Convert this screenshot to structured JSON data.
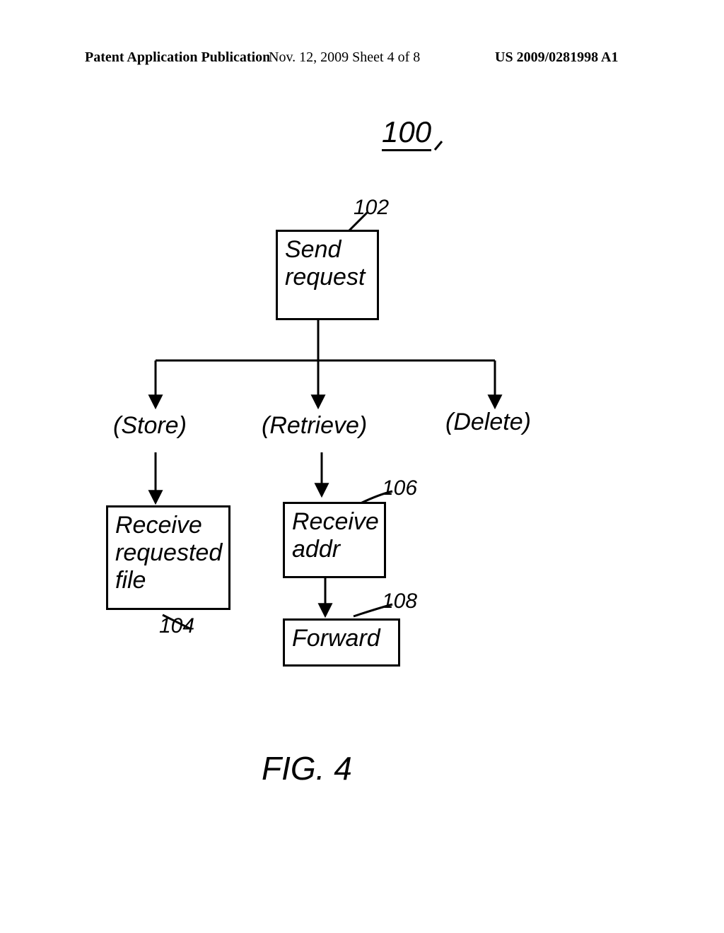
{
  "header": {
    "left": "Patent Application Publication",
    "center": "Nov. 12, 2009  Sheet 4 of 8",
    "right": "US 2009/0281998 A1"
  },
  "refs": {
    "overall": "100",
    "send": "102",
    "recvfile": "104",
    "recvaddr": "106",
    "forward": "108"
  },
  "nodes": {
    "send_request": "Send\nrequest",
    "store": "(Store)",
    "retrieve": "(Retrieve)",
    "delete": "(Delete)",
    "receive_file": "Receive\nrequested\nfile",
    "receive_addr": "Receive\naddr",
    "forward": "Forward"
  },
  "figure_caption": "FIG. 4"
}
